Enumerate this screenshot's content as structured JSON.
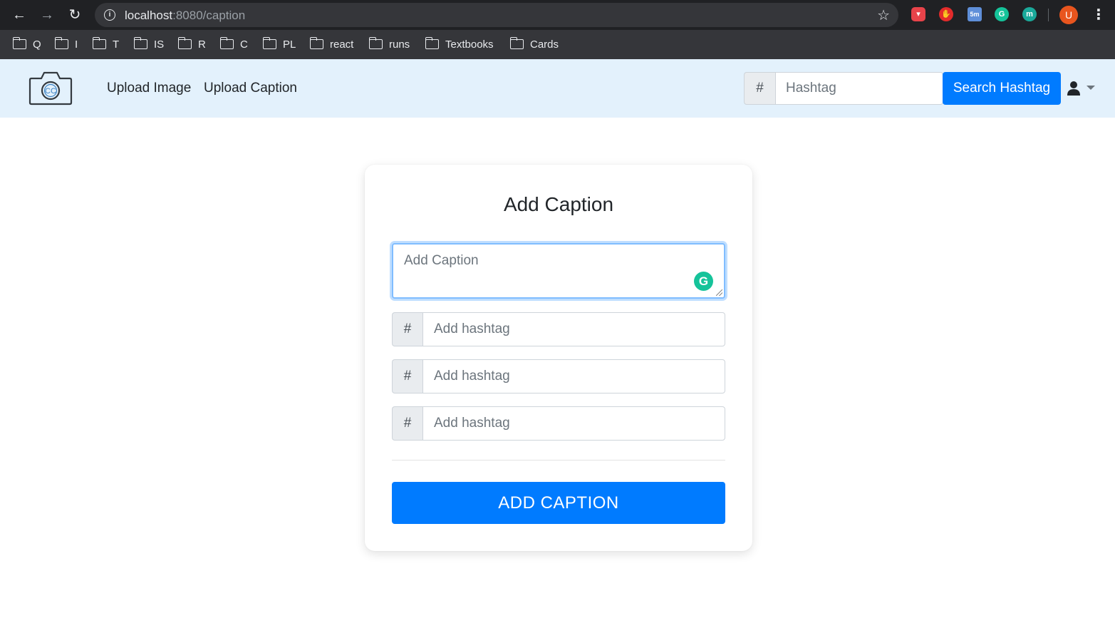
{
  "browser": {
    "url_host": "localhost",
    "url_path": ":8080/caption",
    "extensions": [
      {
        "name": "shield-ext-icon",
        "color": "#e8434a",
        "glyph": "▾"
      },
      {
        "name": "hand-ext-icon",
        "color": "#e32b2b",
        "glyph": "✋"
      },
      {
        "name": "calendar-ext-icon",
        "color": "#5f8fd9",
        "glyph": "5m"
      },
      {
        "name": "grammarly-ext-icon",
        "color": "#15c39a",
        "glyph": "G"
      },
      {
        "name": "m-ext-icon",
        "color": "#1aa99a",
        "glyph": "m"
      }
    ],
    "avatar_letter": "U",
    "bookmarks": [
      "Q",
      "I",
      "T",
      "IS",
      "R",
      "C",
      "PL",
      "react",
      "runs",
      "Textbooks",
      "Cards"
    ]
  },
  "navbar": {
    "links": [
      "Upload Image",
      "Upload Caption"
    ],
    "search_prefix": "#",
    "search_placeholder": "Hashtag",
    "search_button": "Search Hashtag"
  },
  "card": {
    "title": "Add Caption",
    "caption_placeholder": "Add Caption",
    "hashtag_prefix": "#",
    "hashtag_placeholder": "Add hashtag",
    "hashtag_count": 3,
    "submit_label": "ADD CAPTION"
  },
  "colors": {
    "primary": "#007bff",
    "navbar_bg": "#e3f1fc",
    "grammarly": "#15c39a"
  }
}
